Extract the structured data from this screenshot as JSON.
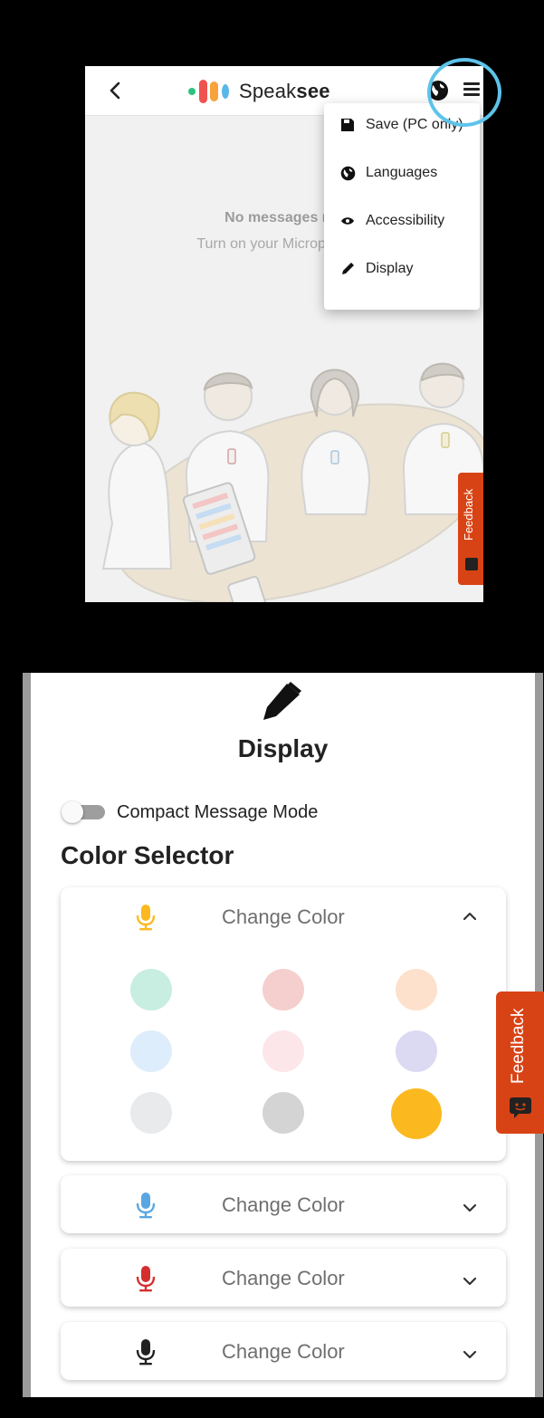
{
  "top_screen": {
    "header": {
      "back_icon": "chevron-left-icon",
      "brand_regular": "Speak",
      "brand_bold": "see",
      "globe_icon": "globe-icon",
      "menu_icon": "hamburger-menu-icon"
    },
    "empty_state": {
      "title": "No messages rec",
      "subtitle": "Turn on your Microphone K"
    },
    "dropdown": {
      "items": [
        {
          "label": "Save (PC only)",
          "icon": "save-icon"
        },
        {
          "label": "Languages",
          "icon": "globe-icon"
        },
        {
          "label": "Accessibility",
          "icon": "eye-icon"
        },
        {
          "label": "Display",
          "icon": "pencil-icon"
        }
      ]
    },
    "feedback_label": "Feedback"
  },
  "display_screen": {
    "icon": "pencil-icon",
    "title": "Display",
    "compact_mode": {
      "label": "Compact Message Mode",
      "enabled": false
    },
    "color_selector_title": "Color Selector",
    "cards": [
      {
        "label": "Change Color",
        "mic_color": "#fbb91f",
        "expanded": true,
        "chevron": "chevron-up-icon"
      },
      {
        "label": "Change Color",
        "mic_color": "#5aa6e0",
        "expanded": false,
        "chevron": "chevron-down-icon"
      },
      {
        "label": "Change Color",
        "mic_color": "#d32f2f",
        "expanded": false,
        "chevron": "chevron-down-icon"
      },
      {
        "label": "Change Color",
        "mic_color": "#222222",
        "expanded": false,
        "chevron": "chevron-down-icon"
      }
    ],
    "swatches": [
      {
        "color": "#c8ede1",
        "selected": false
      },
      {
        "color": "#f5cfcd",
        "selected": false
      },
      {
        "color": "#fde1cc",
        "selected": false
      },
      {
        "color": "#ddedfb",
        "selected": false
      },
      {
        "color": "#fce6ea",
        "selected": false
      },
      {
        "color": "#dcd9f3",
        "selected": false
      },
      {
        "color": "#e8eaec",
        "selected": false
      },
      {
        "color": "#d3d4d3",
        "selected": false
      },
      {
        "color": "#fbb91f",
        "selected": true
      }
    ],
    "feedback_label": "Feedback"
  },
  "colors": {
    "feedback": "#d84315",
    "highlight_ring": "#5ec3ea",
    "logo_green": "#2ec27e",
    "logo_red": "#ef5350",
    "logo_orange": "#f7a23b",
    "logo_blue": "#5ab7e8"
  }
}
